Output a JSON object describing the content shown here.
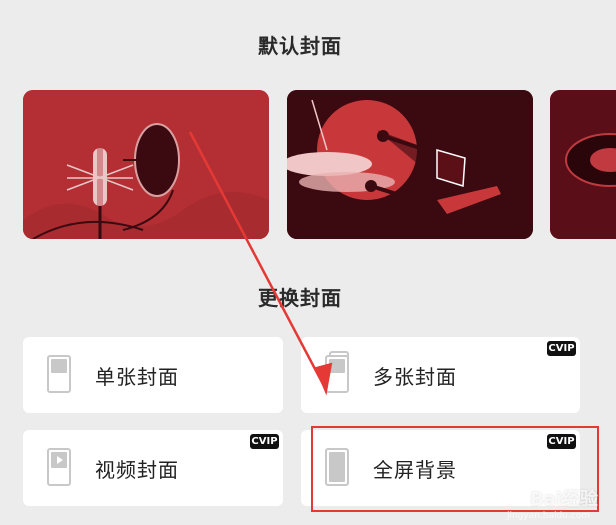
{
  "sections": {
    "default_cover_title": "默认封面",
    "change_cover_title": "更换封面"
  },
  "options": {
    "single": {
      "label": "单张封面",
      "vip": false
    },
    "multi": {
      "label": "多张封面",
      "vip": true,
      "badge": "CVIP"
    },
    "video": {
      "label": "视频封面",
      "vip": true,
      "badge": "CVIP"
    },
    "full": {
      "label": "全屏背景",
      "vip": true,
      "badge": "CVIP"
    }
  },
  "colors": {
    "cover_red": "#b42f34",
    "cover_dark": "#3a0a10",
    "highlight": "#e53935"
  },
  "watermark": {
    "text": "Bai经验",
    "sub": "jingyan.baidu.com"
  }
}
